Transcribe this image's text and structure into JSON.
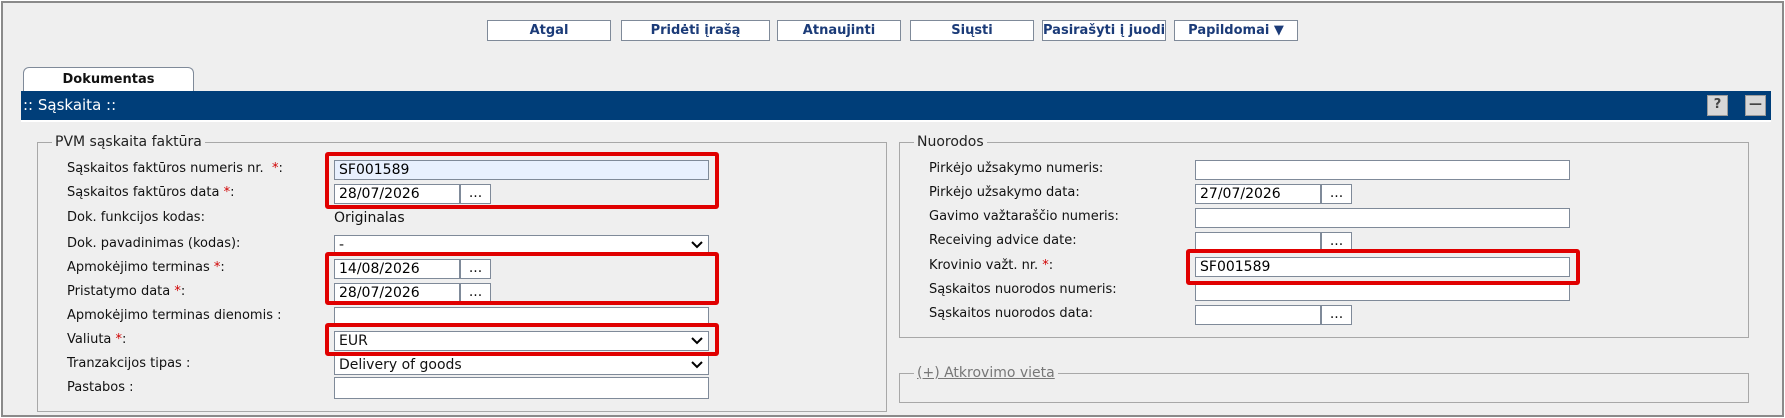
{
  "toolbar": {
    "buttons": [
      "Atgal",
      "Pridėti įrašą",
      "Atnaujinti",
      "Siųsti",
      "Pasirašyti į juodi",
      "Papildomai ▼"
    ]
  },
  "tab": {
    "label": "Dokumentas"
  },
  "panel": {
    "title": ":: Sąskaita ::"
  },
  "invoice": {
    "legend": "PVM sąskaita faktūra",
    "number_label": "Sąskaitos faktūros numeris nr.",
    "number_value": "SF001589",
    "date_label": "Sąskaitos faktūros data",
    "date_value": "28/07/2026",
    "func_code_label": "Dok. funkcijos kodas:",
    "func_code_value": "Originalas",
    "doc_name_label": "Dok. pavadinimas (kodas):",
    "doc_name_value": "-",
    "due_label": "Apmokėjimo terminas",
    "due_value": "14/08/2026",
    "delivery_label": "Pristatymo data",
    "delivery_value": "28/07/2026",
    "due_days_label": "Apmokėjimo terminas dienomis :",
    "due_days_value": "",
    "currency_label": "Valiuta",
    "currency_value": "EUR",
    "transaction_label": "Tranzakcijos tipas :",
    "transaction_value": "Delivery of goods",
    "notes_label": "Pastabos :",
    "notes_value": ""
  },
  "refs": {
    "legend": "Nuorodos",
    "order_no_label": "Pirkėjo užsakymo numeris:",
    "order_no_value": "",
    "order_date_label": "Pirkėjo užsakymo data:",
    "order_date_value": "27/07/2026",
    "waybill_label": "Gavimo važtaraščio numeris:",
    "waybill_value": "",
    "advice_label": "Receiving advice date:",
    "advice_value": "",
    "cargo_label": "Krovinio važt. nr.",
    "cargo_value": "SF001589",
    "ref_no_label": "Sąskaitos nuorodos numeris:",
    "ref_no_value": "",
    "ref_date_label": "Sąskaitos nuorodos data:",
    "ref_date_value": ""
  },
  "recovery": {
    "legend": "(+) Atkrovimo vieta"
  },
  "common": {
    "colon": ":",
    "star": "*",
    "dots": "...",
    "help": "?",
    "minimize": "—"
  },
  "colors": {
    "title_bar": "#003e79",
    "highlight": "#e00000",
    "button_text": "#1b3b78"
  }
}
